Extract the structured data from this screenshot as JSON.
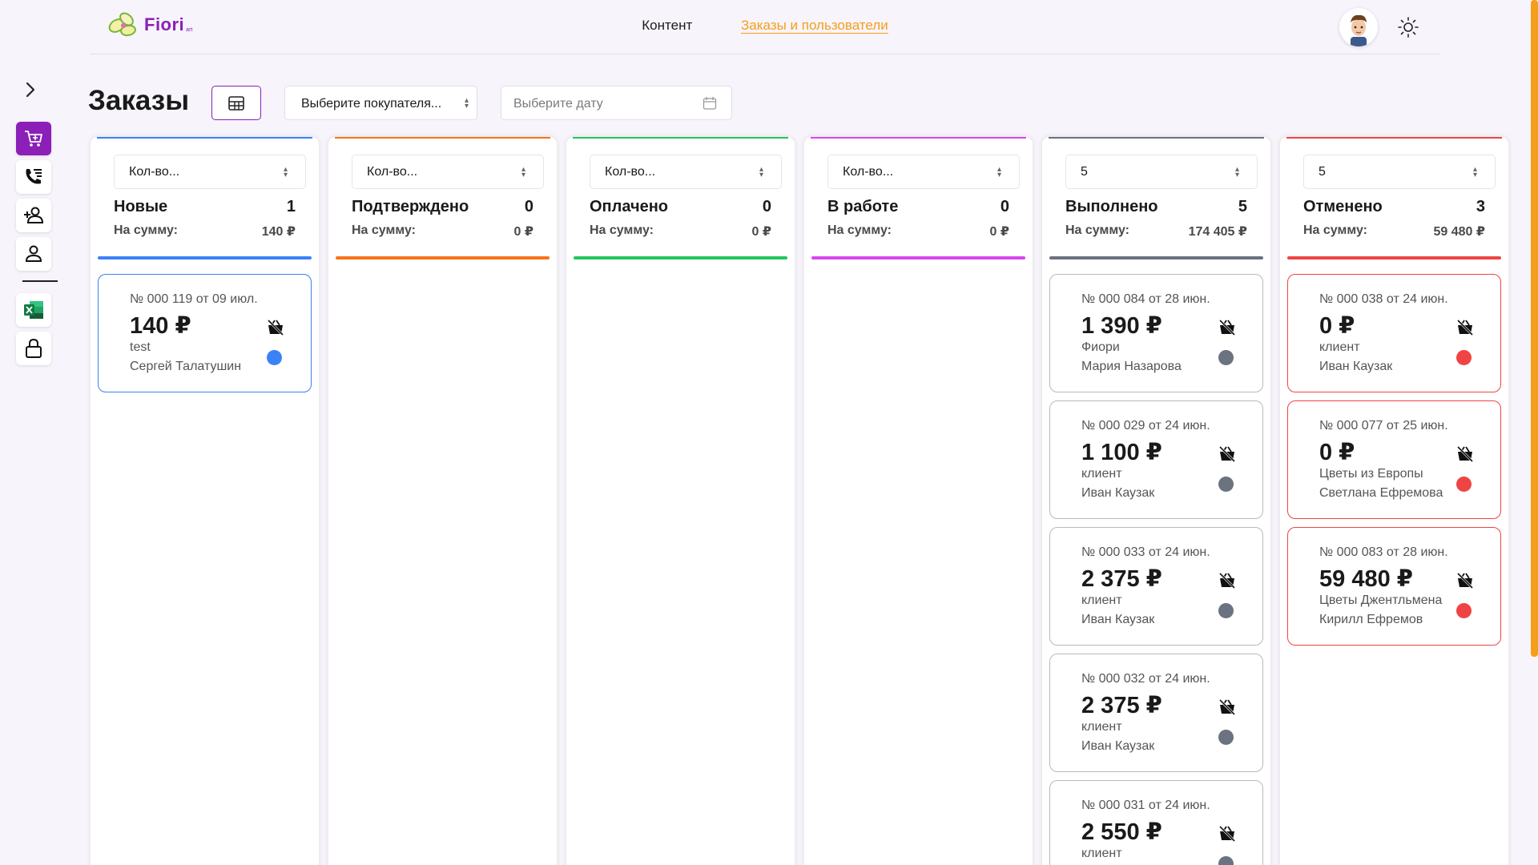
{
  "brand": {
    "name": "Fiori",
    "sub": "art"
  },
  "nav": {
    "content": "Контент",
    "orders_users": "Заказы и пользователи"
  },
  "sidebar": {
    "items": [
      {
        "name": "cart-icon"
      },
      {
        "name": "phone-list-icon"
      },
      {
        "name": "add-user-icon"
      },
      {
        "name": "user-icon"
      },
      {
        "name": "excel-icon"
      },
      {
        "name": "lock-icon"
      }
    ]
  },
  "page": {
    "title": "Заказы",
    "buyer_placeholder": "Выберите покупателя...",
    "date_placeholder": "Выберите дату"
  },
  "sum_label": "На сумму:",
  "columns": [
    {
      "qty": "Кол-во...",
      "name": "Новые",
      "count": "1",
      "sum": "140 ₽",
      "color": "#3b82f6",
      "cards": [
        {
          "num": "№ 000 119 от 09 июл.",
          "price": "140 ₽",
          "type": "test",
          "user": "Сергей Талатушин"
        }
      ]
    },
    {
      "qty": "Кол-во...",
      "name": "Подтверждено",
      "count": "0",
      "sum": "0 ₽",
      "color": "#f97316",
      "cards": []
    },
    {
      "qty": "Кол-во...",
      "name": "Оплачено",
      "count": "0",
      "sum": "0 ₽",
      "color": "#22c55e",
      "cards": []
    },
    {
      "qty": "Кол-во...",
      "name": "В работе",
      "count": "0",
      "sum": "0 ₽",
      "color": "#d946ef",
      "cards": []
    },
    {
      "qty": "5",
      "name": "Выполнено",
      "count": "5",
      "sum": "174 405 ₽",
      "color": "#6b7280",
      "cards": [
        {
          "num": "№ 000 084 от 28 июн.",
          "price": "1 390 ₽",
          "type": "Фиори",
          "user": "Мария Назарова"
        },
        {
          "num": "№ 000 029 от 24 июн.",
          "price": "1 100 ₽",
          "type": "клиент",
          "user": "Иван Каузак"
        },
        {
          "num": "№ 000 033 от 24 июн.",
          "price": "2 375 ₽",
          "type": "клиент",
          "user": "Иван Каузак"
        },
        {
          "num": "№ 000 032 от 24 июн.",
          "price": "2 375 ₽",
          "type": "клиент",
          "user": "Иван Каузак"
        },
        {
          "num": "№ 000 031 от 24 июн.",
          "price": "2 550 ₽",
          "type": "клиент",
          "user": ""
        }
      ]
    },
    {
      "qty": "5",
      "name": "Отменено",
      "count": "3",
      "sum": "59 480 ₽",
      "color": "#ef4444",
      "cards": [
        {
          "num": "№ 000 038 от 24 июн.",
          "price": "0 ₽",
          "type": "клиент",
          "user": "Иван Каузак"
        },
        {
          "num": "№ 000 077 от 25 июн.",
          "price": "0 ₽",
          "type": "Цветы из Европы",
          "user": "Светлана Ефремова"
        },
        {
          "num": "№ 000 083 от 28 июн.",
          "price": "59 480 ₽",
          "type": "Цветы Джентльмена",
          "user": "Кирилл Ефремов"
        }
      ]
    }
  ]
}
